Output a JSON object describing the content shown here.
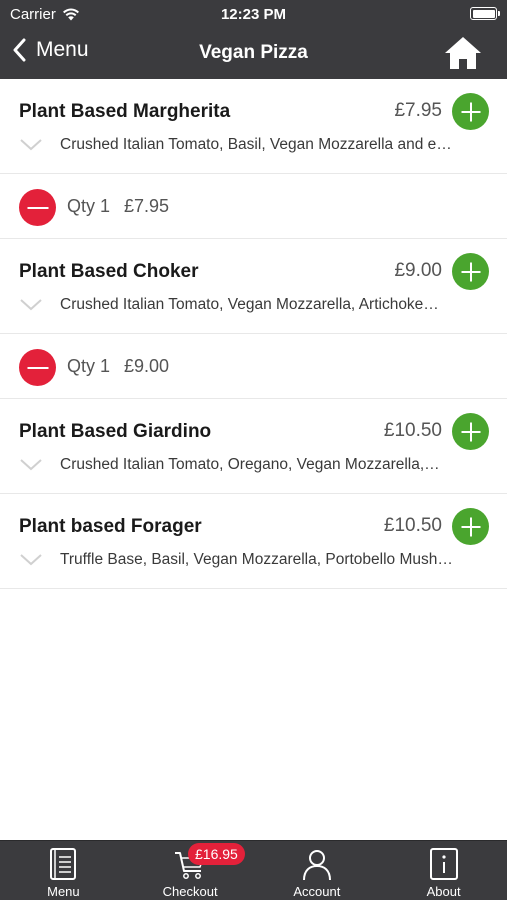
{
  "status_bar": {
    "carrier": "Carrier",
    "time": "12:23 PM"
  },
  "nav": {
    "back_label": "Menu",
    "title": "Vegan Pizza"
  },
  "items": [
    {
      "name": "Plant Based Margherita",
      "price": "£7.95",
      "description": "Crushed Italian Tomato, Basil, Vegan Mozzarella and e…"
    },
    {
      "name": "Plant Based Choker",
      "price": "£9.00",
      "description": "Crushed Italian Tomato, Vegan Mozzarella, Artichoke…"
    },
    {
      "name": "Plant Based Giardino",
      "price": "£10.50",
      "description": "Crushed Italian Tomato, Oregano, Vegan Mozzarella,…"
    },
    {
      "name": "Plant based Forager",
      "price": "£10.50",
      "description": "Truffle Base, Basil, Vegan Mozzarella, Portobello Mush…"
    }
  ],
  "cart_lines": [
    {
      "qty": "Qty 1",
      "price": "£7.95"
    },
    {
      "qty": "Qty 1",
      "price": "£9.00"
    }
  ],
  "tabbar": {
    "menu": "Menu",
    "checkout": "Checkout",
    "checkout_badge": "£16.95",
    "account": "Account",
    "about": "About"
  },
  "icons": {
    "back": "chevron-left-icon",
    "home": "home-icon",
    "add": "plus-icon",
    "remove": "minus-icon",
    "expand": "chevron-down-icon",
    "menu_tab": "book-icon",
    "checkout_tab": "cart-icon",
    "account_tab": "user-icon",
    "about_tab": "info-icon"
  },
  "colors": {
    "header_bg": "#3b3b3e",
    "add_green": "#4aa52e",
    "remove_red": "#e3213a"
  }
}
